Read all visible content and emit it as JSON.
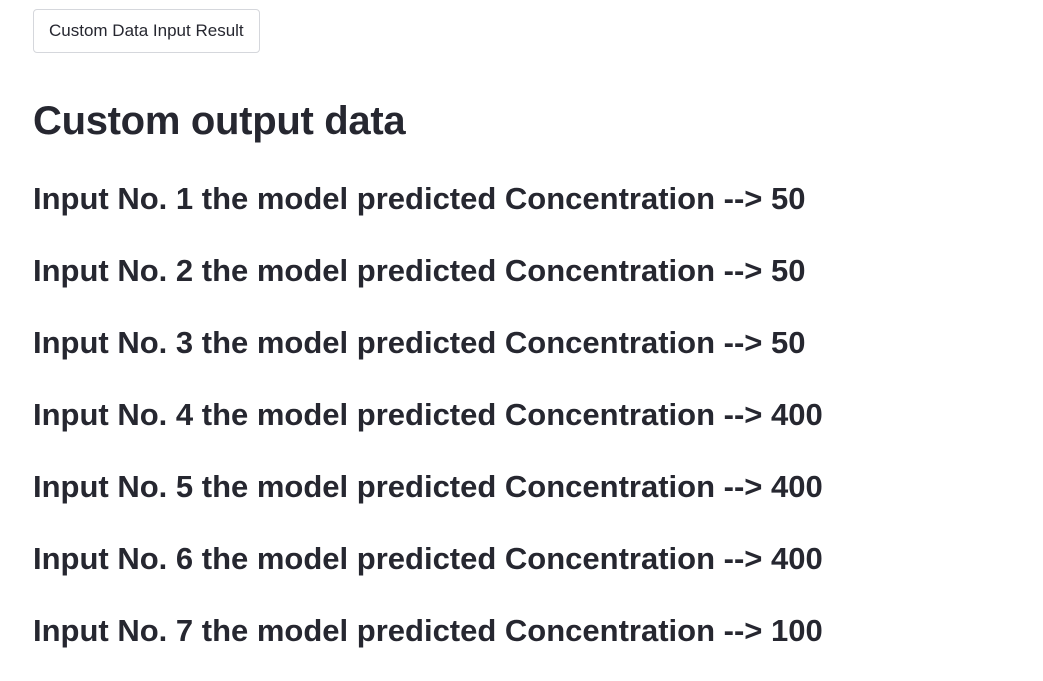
{
  "button": {
    "label": "Custom Data Input Result"
  },
  "heading": "Custom output data",
  "results": [
    "Input No. 1 the model predicted Concentration --> 50",
    "Input No. 2 the model predicted Concentration --> 50",
    "Input No. 3 the model predicted Concentration --> 50",
    "Input No. 4 the model predicted Concentration --> 400",
    "Input No. 5 the model predicted Concentration --> 400",
    "Input No. 6 the model predicted Concentration --> 400",
    "Input No. 7 the model predicted Concentration --> 100"
  ]
}
